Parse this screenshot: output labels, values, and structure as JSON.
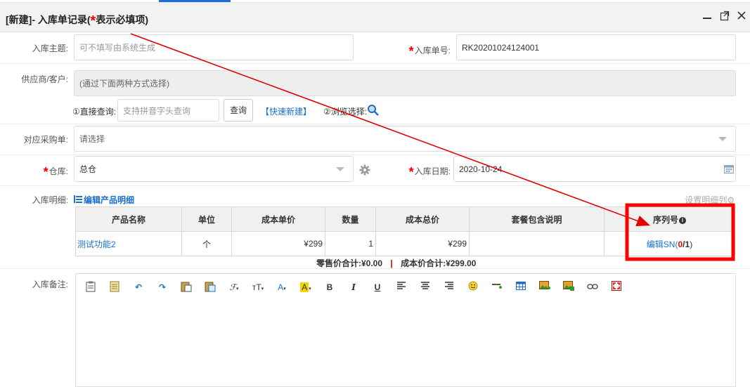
{
  "dialog": {
    "title_prefix": "[新建]- 入库单记录(",
    "title_star": "*",
    "title_suffix": "表示必填项)",
    "minimize_icon": "minimize-icon",
    "maximize_icon": "maximize-icon",
    "close_icon": "close-icon"
  },
  "form": {
    "subject_label": "入库主题:",
    "subject_placeholder": "可不填写由系统生成",
    "order_no_label": "入库单号:",
    "order_no_value": "RK20201024124001",
    "supplier_label": "供应商/客户:",
    "supplier_value": "(通过下面两种方式选择)",
    "direct_query_label": "①直接查询:",
    "direct_query_placeholder": "支持拼音字头查询",
    "query_button": "查询",
    "quick_new_link": "【快速新建】",
    "browse_select_label": "②浏览选择:",
    "purchase_order_label": "对应采购单:",
    "purchase_order_value": "请选择",
    "warehouse_label": "仓库:",
    "warehouse_value": "总仓",
    "date_label": "入库日期:",
    "date_value": "2020-10-24",
    "detail_label": "入库明细:",
    "edit_detail_link": "编辑产品明细",
    "set_columns_link": "设置明细列",
    "remarks_label": "入库备注:",
    "required_star": "*"
  },
  "table": {
    "headers": [
      "产品名称",
      "单位",
      "成本单价",
      "数量",
      "成本总价",
      "套餐包含说明",
      "序列号"
    ],
    "rows": [
      {
        "product": "测试功能2",
        "unit": "个",
        "unit_price": "¥299",
        "qty": "1",
        "total": "¥299",
        "package_desc": "",
        "sn_link_prefix": "编辑SN(",
        "sn_done": "0",
        "sn_slash": "/",
        "sn_total": "1",
        "sn_suffix": ")"
      }
    ]
  },
  "totals": {
    "retail_label": "零售价合计:",
    "retail_value": "¥0.00",
    "divider": "|",
    "cost_label": "成本价合计:",
    "cost_value": "¥299.00"
  },
  "colors": {
    "accent": "#1a6fc9",
    "required": "#e00000",
    "highlight_box": "#ff0000",
    "annotation_arrow": "#e00000"
  },
  "editor_toolbar_icons": [
    "paste-text-icon",
    "paste-word-icon",
    "undo-icon",
    "redo-icon",
    "paste-icon",
    "paste-plain-icon",
    "font-family-icon",
    "font-size-icon",
    "font-color-icon",
    "highlight-color-icon",
    "bold-icon",
    "italic-icon",
    "underline-icon",
    "align-left-icon",
    "align-center-icon",
    "align-right-icon",
    "emoji-icon",
    "horizontal-rule-icon",
    "table-icon",
    "image-icon",
    "multi-image-icon",
    "link-icon",
    "fullscreen-icon"
  ],
  "toolbar_glyphs": {
    "font_family": "ℱ",
    "font_size": "тT",
    "font_color": "A",
    "highlight": "A",
    "bold": "B",
    "italic": "I",
    "underline": "U"
  }
}
